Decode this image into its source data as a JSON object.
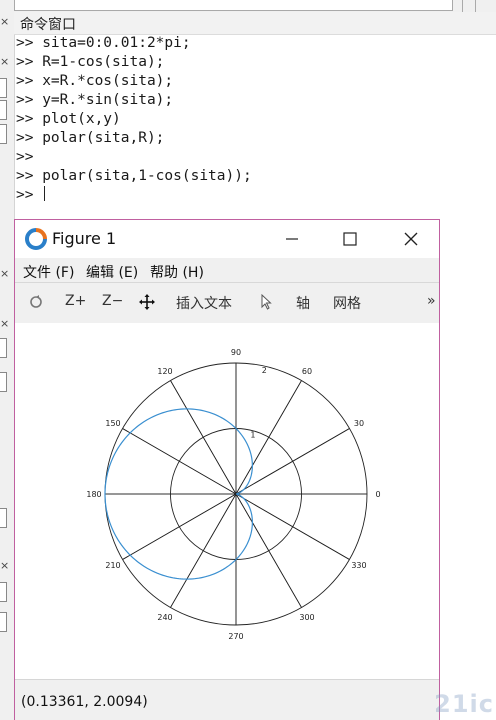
{
  "command_window": {
    "title": "命令窗口",
    "lines": [
      ">> sita=0:0.01:2*pi;",
      ">> R=1-cos(sita);",
      ">> x=R.*cos(sita);",
      ">> y=R.*sin(sita);",
      ">> plot(x,y)",
      ">> polar(sita,R);",
      ">>",
      ">> polar(sita,1-cos(sita));",
      ">> "
    ]
  },
  "figure": {
    "title": "Figure 1",
    "menus": [
      "文件 (F)",
      "编辑 (E)",
      "帮助 (H)"
    ],
    "toolbar": {
      "zoom_in": "Z+",
      "zoom_out": "Z−",
      "insert_text": "插入文本",
      "axis": "轴",
      "grid": "网格",
      "more": "»"
    },
    "status": "(0.13361, 2.0094)",
    "watermark": "21ic"
  },
  "chart_data": {
    "type": "polar",
    "equation_plotted": "R = 1 - cos(sita)",
    "series": [
      {
        "name": "",
        "color": "#3a8fd0",
        "theta_deg": [
          0,
          30,
          60,
          90,
          120,
          150,
          180,
          210,
          240,
          270,
          300,
          330,
          360
        ],
        "r": [
          0,
          0.134,
          0.5,
          1,
          1.5,
          1.866,
          2,
          1.866,
          1.5,
          1,
          0.5,
          0.134,
          0
        ]
      }
    ],
    "angle_ticks": [
      "0",
      "30",
      "60",
      "90",
      "120",
      "150",
      "180",
      "210",
      "240",
      "270",
      "300",
      "330"
    ],
    "radial_ticks": [
      "1",
      "2"
    ],
    "rmax": 2
  }
}
